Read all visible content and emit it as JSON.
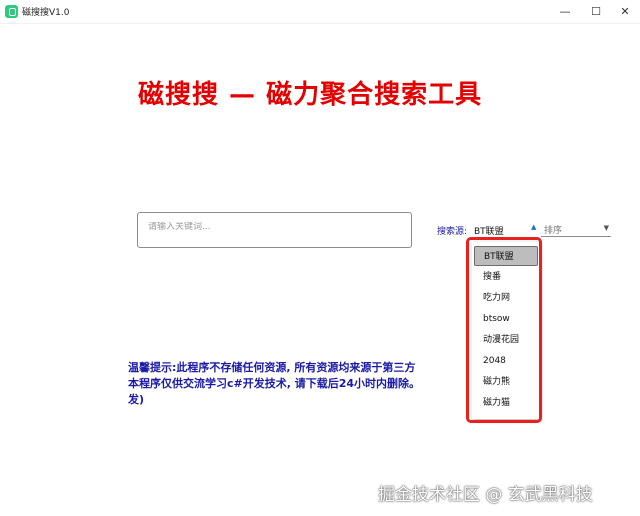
{
  "window": {
    "title": "磁搜搜V1.0",
    "minimize_glyph": "—",
    "maximize_glyph": "☐",
    "close_glyph": "✕"
  },
  "banner": {
    "text": "磁搜搜 — 磁力聚合搜索工具",
    "color": "#e40000"
  },
  "search": {
    "value": "",
    "placeholder": "请输入关键词..."
  },
  "source": {
    "label": "搜索源:",
    "selected": "BT联盟",
    "caret_icon": "caret-up-icon"
  },
  "sort": {
    "placeholder": "排序",
    "caret_icon": "caret-down-icon"
  },
  "dropdown": {
    "items": [
      "BT联盟",
      "搜番",
      "吃力网",
      "btsow",
      "动漫花园",
      "2048",
      "磁力熊",
      "磁力猫"
    ],
    "selected_index": 0
  },
  "highlight_color": "#e8201e",
  "notice": {
    "line1": "温馨提示:此程序不存储任何资源, 所有资源均来源于第三方",
    "line2": "本程序仅供交流学习c#开发技术, 请下载后24小时内删除。",
    "line3": "发)",
    "color": "#1a1aa6"
  },
  "watermark": "掘金技术社区 @ 玄武黑科技"
}
